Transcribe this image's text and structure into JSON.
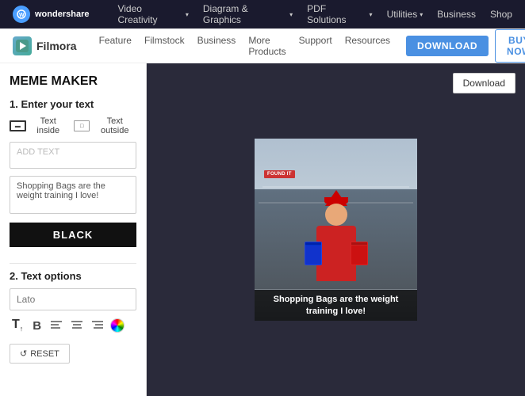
{
  "topnav": {
    "logo_icon": "W",
    "logo_text": "wondershare",
    "items": [
      {
        "label": "Video Creativity",
        "has_chevron": true
      },
      {
        "label": "Diagram & Graphics",
        "has_chevron": true
      },
      {
        "label": "PDF Solutions",
        "has_chevron": true
      },
      {
        "label": "Utilities",
        "has_chevron": true
      },
      {
        "label": "Business",
        "has_chevron": false
      },
      {
        "label": "Shop",
        "has_chevron": false
      }
    ]
  },
  "secondnav": {
    "brand_name": "Filmora",
    "items": [
      "Feature",
      "Filmstock",
      "Business",
      "More Products",
      "Support",
      "Resources"
    ],
    "download_btn": "DOWNLOAD",
    "buy_btn": "BUY NOW"
  },
  "sidebar": {
    "title": "MEME MAKER",
    "section1_title": "1. Enter your text",
    "text_inside_label": "Text inside",
    "text_outside_label": "Text outside",
    "top_textarea_placeholder": "ADD TEXT",
    "bottom_textarea_value": "Shopping Bags are the weight training I love!",
    "color_btn_label": "BLACK",
    "section2_title": "2. Text options",
    "font_placeholder": "Lato",
    "format_buttons": [
      "T↑",
      "B",
      "≡",
      "≡",
      "≡"
    ],
    "reset_btn_label": "RESET"
  },
  "canvas": {
    "download_btn": "Download",
    "meme_caption": "Shopping Bags are the weight training I love!",
    "found_tag": "FOUND IT"
  }
}
